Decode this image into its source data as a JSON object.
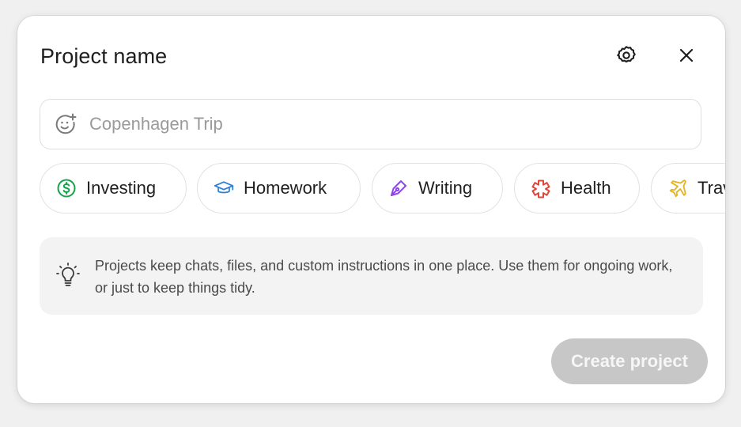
{
  "dialog": {
    "title": "Project name",
    "settings_icon": "gear-icon",
    "close_icon": "close-icon"
  },
  "name_input": {
    "value": "",
    "placeholder": "Copenhagen Trip",
    "icon": "emoji-add-icon"
  },
  "categories": [
    {
      "label": "Investing",
      "icon": "dollar-circle-icon",
      "color": "#16a34a"
    },
    {
      "label": "Homework",
      "icon": "graduation-cap-icon",
      "color": "#2b7fd6"
    },
    {
      "label": "Writing",
      "icon": "pen-nib-icon",
      "color": "#8b46e8"
    },
    {
      "label": "Health",
      "icon": "health-cross-icon",
      "color": "#e0453a"
    },
    {
      "label": "Travel",
      "icon": "airplane-icon",
      "color": "#e6b422"
    }
  ],
  "info": {
    "icon": "lightbulb-icon",
    "text": "Projects keep chats, files, and custom instructions in one place. Use them for ongoing work, or just to keep things tidy."
  },
  "actions": {
    "create_label": "Create project",
    "create_disabled_color": "#c7c7c7"
  }
}
